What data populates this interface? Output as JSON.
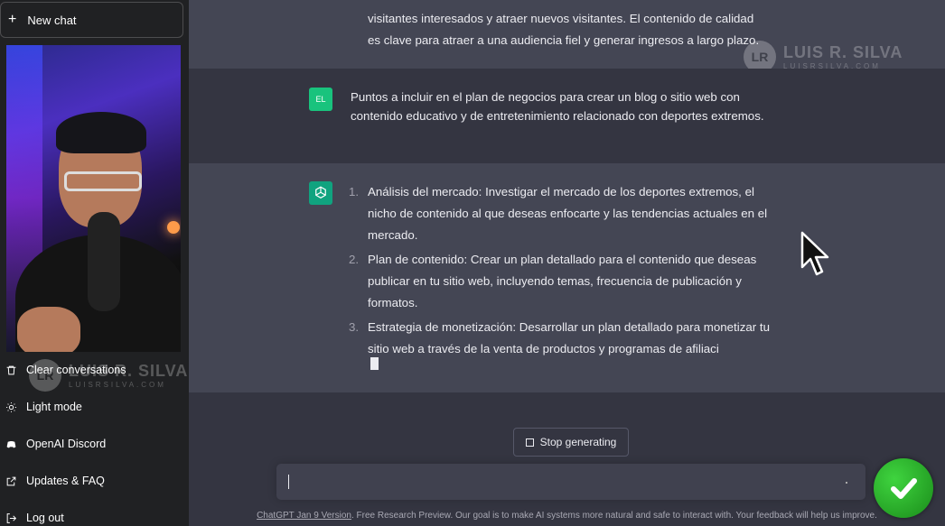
{
  "sidebar": {
    "new_chat_label": "New chat",
    "items": [
      {
        "label": "Clear conversations",
        "icon": "trash-icon"
      },
      {
        "label": "Light mode",
        "icon": "sun-icon"
      },
      {
        "label": "OpenAI Discord",
        "icon": "discord-icon"
      },
      {
        "label": "Updates & FAQ",
        "icon": "external-link-icon"
      },
      {
        "label": "Log out",
        "icon": "logout-icon"
      }
    ]
  },
  "watermark": {
    "initial": "LR",
    "name": "LUIS R. SILVA",
    "url": "LUISRSILVA.COM"
  },
  "chat": {
    "prev_response": {
      "line1": "visitantes interesados y atraer nuevos visitantes. El contenido de calidad",
      "line2": "es clave para atraer a una audiencia fiel y generar ingresos a largo plazo."
    },
    "user_message": {
      "avatar": "EL",
      "text": "Puntos a incluir en el plan de negocios para crear un blog o sitio web con contenido educativo y de entretenimiento relacionado con deportes extremos."
    },
    "response_items": [
      {
        "num": "1.",
        "text": "Análisis del mercado: Investigar el mercado de los deportes extremos, el nicho de contenido al que deseas enfocarte y las tendencias actuales en el mercado."
      },
      {
        "num": "2.",
        "text": "Plan de contenido: Crear un plan detallado para el contenido que deseas publicar en tu sitio web, incluyendo temas, frecuencia de publicación y formatos."
      },
      {
        "num": "3.",
        "text": "Estrategia de monetización: Desarrollar un plan detallado para monetizar tu sitio web a través de la venta de productos y programas de afiliaci"
      }
    ]
  },
  "controls": {
    "stop_label": "Stop generating",
    "input_value": ""
  },
  "footer": {
    "link": "ChatGPT Jan 9 Version",
    "text": ". Free Research Preview. Our goal is to make AI systems more natural and safe to interact with. Your feedback will help us improve."
  },
  "colors": {
    "user_avatar": "#19c37d",
    "assistant_avatar": "#10a37f",
    "check": "#22b022"
  }
}
